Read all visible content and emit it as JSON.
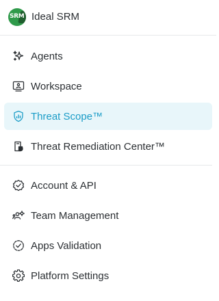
{
  "app": {
    "logo_text": "SRM",
    "title": "Ideal SRM"
  },
  "colors": {
    "accent": "#1a9cc7",
    "active_background": "#e8f6fa",
    "text": "#2b2f33",
    "logo_green": "#2f9a4a"
  },
  "nav": {
    "primary": [
      {
        "label": "Agents",
        "icon": "sparkle-icon"
      },
      {
        "label": "Workspace",
        "icon": "workspace-icon"
      },
      {
        "label": "Threat Scope™",
        "icon": "shield-chart-icon",
        "active": true
      },
      {
        "label": "Threat Remediation Center™",
        "icon": "remediation-icon"
      }
    ],
    "secondary": [
      {
        "label": "Account & API",
        "icon": "badge-check-icon"
      },
      {
        "label": "Team Management",
        "icon": "team-icon"
      },
      {
        "label": "Apps Validation",
        "icon": "check-circle-dashed-icon"
      },
      {
        "label": "Platform Settings",
        "icon": "gear-icon"
      }
    ]
  }
}
